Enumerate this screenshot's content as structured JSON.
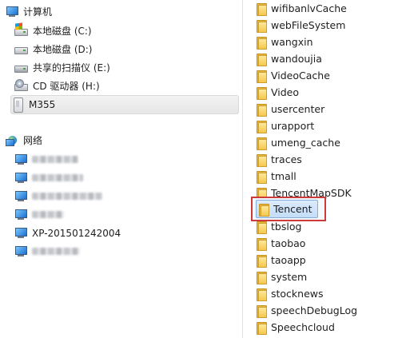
{
  "tree": {
    "computer": {
      "label": "计算机"
    },
    "drives": [
      {
        "label": "本地磁盘 (C:)",
        "icon": "windows-drive-icon"
      },
      {
        "label": "本地磁盘 (D:)",
        "icon": "drive-icon"
      },
      {
        "label": "共享的扫描仪 (E:)",
        "icon": "scanner-drive-icon"
      },
      {
        "label": "CD 驱动器 (H:)",
        "icon": "cd-drive-icon"
      },
      {
        "label": "M355",
        "icon": "phone-icon",
        "selected": true
      }
    ],
    "network": {
      "label": "网络"
    },
    "network_items": [
      {
        "label": ""
      },
      {
        "label": ""
      },
      {
        "label": ""
      },
      {
        "label": ""
      },
      {
        "label": "XP-201501242004"
      },
      {
        "label": ""
      }
    ]
  },
  "folders": [
    "wifibanlvCache",
    "webFileSystem",
    "wangxin",
    "wandoujia",
    "VideoCache",
    "Video",
    "usercenter",
    "urapport",
    "umeng_cache",
    "traces",
    "tmall",
    "TencentMapSDK",
    "Tencent",
    "tbslog",
    "taobao",
    "taoapp",
    "system",
    "stocknews",
    "speechDebugLog",
    "Speechcloud"
  ],
  "highlighted_folder": "Tencent",
  "colors": {
    "highlight_border": "#cc3b3b",
    "selection": "#c4ddf8",
    "folder": "#f5c84c"
  }
}
